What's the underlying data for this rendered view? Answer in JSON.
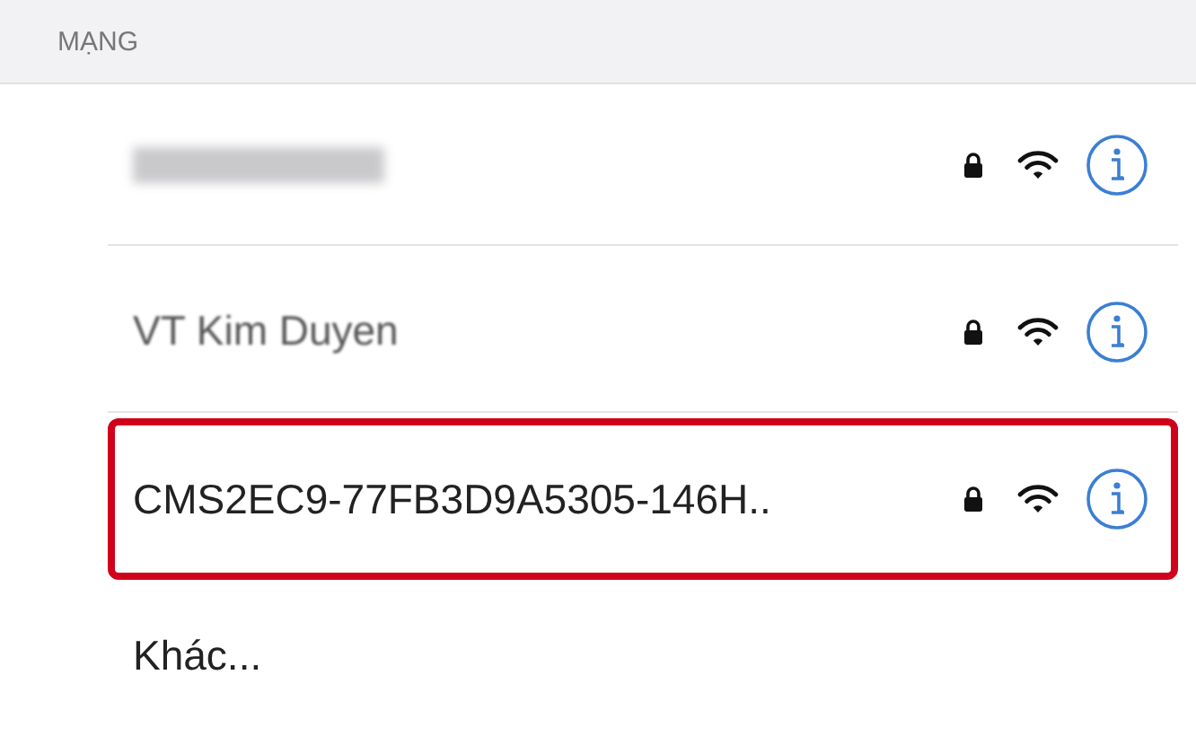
{
  "section_header": "MẠNG",
  "networks": [
    {
      "kind": "redacted",
      "locked": true,
      "highlighted": false
    },
    {
      "kind": "blurred",
      "name": "VT Kim Duyen",
      "locked": true,
      "highlighted": false
    },
    {
      "kind": "plain",
      "name": "CMS2EC9-77FB3D9A5305-146H..",
      "locked": true,
      "highlighted": true
    }
  ],
  "other": "Khác..."
}
